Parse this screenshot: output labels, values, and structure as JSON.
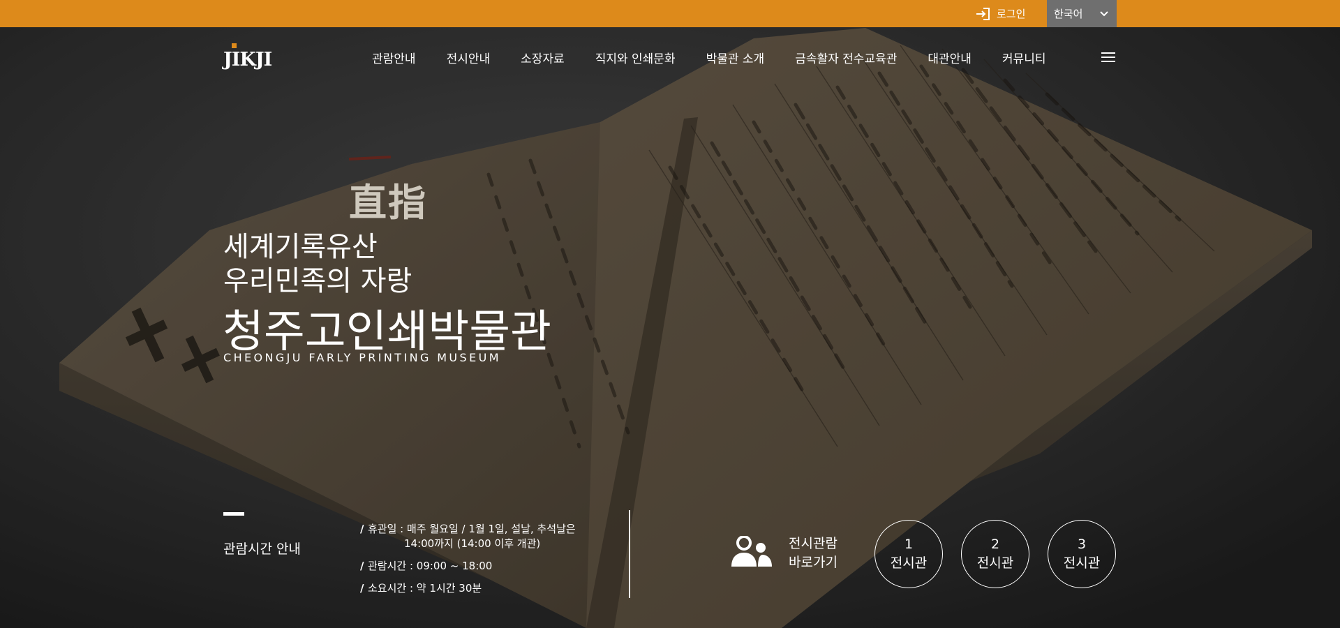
{
  "topbar": {
    "login_label": "로그인",
    "language": "한국어",
    "accent_color": "#dd8a1b"
  },
  "header": {
    "logo_text": "JIKJI",
    "nav": [
      {
        "label": "관람안내"
      },
      {
        "label": "전시안내"
      },
      {
        "label": "소장자료"
      },
      {
        "label": "직지와 인쇄문화"
      },
      {
        "label": "박물관 소개"
      },
      {
        "label": "금속활자 전수교육관"
      },
      {
        "label": "대관안내"
      },
      {
        "label": "커뮤니티"
      }
    ],
    "menu_icon": "hamburger-icon"
  },
  "hero": {
    "hanja": "直指",
    "line1": "세계기록유산",
    "line2": "우리민족의 자랑",
    "title": "청주고인쇄박물관",
    "subtitle": "CHEONGJU FARLY PRINTING MUSEUM"
  },
  "info": {
    "hours_title": "관람시간 안내",
    "closed_a": "휴관일 : 매주 월요일 / 1월 1일, 설날, 추석날은",
    "closed_b": "14:00까지 (14:00 이후 개관)",
    "hours": "관람시간 : 09:00 ~ 18:00",
    "duration": "소요시간 : 약 1시간 30분"
  },
  "exhibit": {
    "go_line1": "전시관람",
    "go_line2": "바로가기",
    "icon": "visitors-icon",
    "halls": [
      {
        "num": "1",
        "label": "전시관"
      },
      {
        "num": "2",
        "label": "전시관"
      },
      {
        "num": "3",
        "label": "전시관"
      }
    ]
  }
}
